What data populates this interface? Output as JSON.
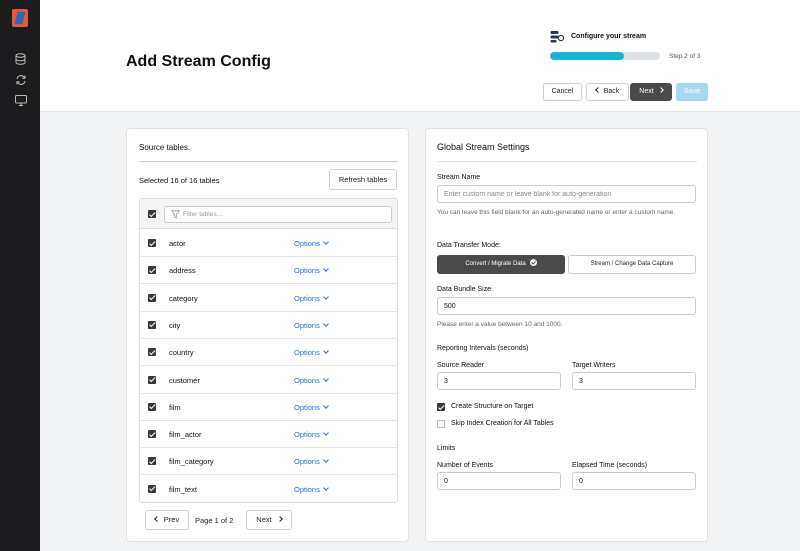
{
  "header": {
    "title": "Add Stream Config",
    "progress": {
      "label": "Configure your stream",
      "step": "Step 2 of 3",
      "fraction": 0.67
    },
    "buttons": {
      "cancel": "Cancel",
      "back": "Back",
      "next": "Next",
      "save": "Save"
    }
  },
  "source": {
    "title": "Source tables.",
    "selected": "Selected 16 of 16 tables",
    "refresh": "Refresh tables",
    "filter_placeholder": "Filter tables...",
    "options_label": "Options",
    "tables": [
      "actor",
      "address",
      "category",
      "city",
      "country",
      "customer",
      "film",
      "film_actor",
      "film_category",
      "film_text"
    ],
    "pagination": {
      "prev": "Prev",
      "indicator": "Page 1 of 2",
      "next": "Next"
    }
  },
  "settings": {
    "title": "Global Stream Settings",
    "stream_name": {
      "label": "Stream Name",
      "placeholder": "Enter custom name or leave blank for auto-generation",
      "hint": "You can leave this field blank for an auto-generated name or enter a custom name."
    },
    "transfer_mode": {
      "label": "Data Transfer Mode:",
      "option_migrate": "Convert / Migrate Data",
      "option_cdc": "Stream / Change Data Capture"
    },
    "bundle": {
      "label": "Data Bundle Size",
      "value": "500",
      "hint": "Please enter a value between 10 and 1000."
    },
    "reporting": {
      "label": "Reporting Intervals (seconds)",
      "source_reader_label": "Source Reader",
      "source_reader_value": "3",
      "target_writers_label": "Target Writers",
      "target_writers_value": "3"
    },
    "create_structure": {
      "label": "Create Structure on Target",
      "checked": true
    },
    "skip_index": {
      "label": "Skip Index Creation for All Tables",
      "checked": false
    },
    "limits": {
      "label": "Limits",
      "events_label": "Number of Events",
      "events_value": "0",
      "elapsed_label": "Elapsed Time (seconds)",
      "elapsed_value": "0"
    }
  },
  "colors": {
    "accent": "#1bb3d2",
    "link": "#2b6cd6",
    "dark_button": "#4a4a4a",
    "save_disabled": "#a9d9f0",
    "logo": "#e8553d"
  },
  "icons": [
    "logo-icon",
    "database-icon",
    "sync-icon",
    "monitor-icon",
    "stream-config-icon",
    "chevron-left-icon",
    "chevron-right-icon",
    "filter-icon",
    "chevron-down-icon",
    "check-circle-icon"
  ]
}
